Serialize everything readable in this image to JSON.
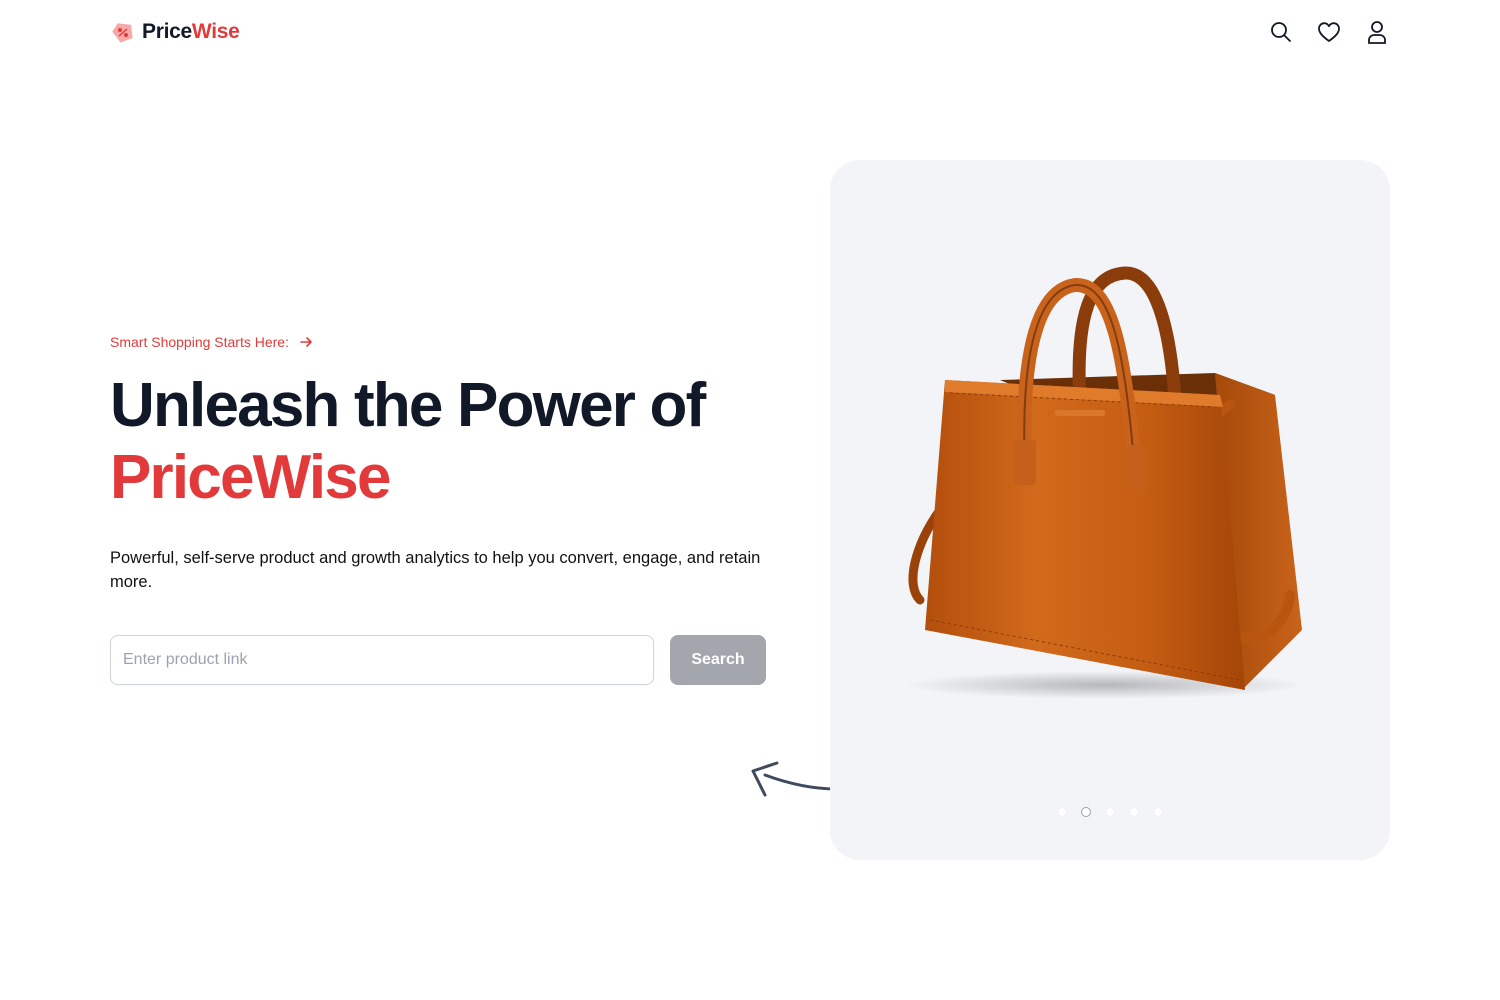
{
  "nav": {
    "logo_part1": "Price",
    "logo_part2": "Wise",
    "logo_icon": "price-tag-icon",
    "icons": [
      "search-icon",
      "heart-icon",
      "user-icon"
    ]
  },
  "hero": {
    "tagline": "Smart Shopping Starts Here:",
    "headline_line1": "Unleash the Power of",
    "headline_brand": "PriceWise",
    "description": "Powerful, self-serve product and growth analytics to help you convert, engage, and retain more.",
    "search": {
      "placeholder": "Enter product link",
      "value": "",
      "button_label": "Search"
    }
  },
  "carousel": {
    "image": "leather-handbag",
    "slide_count": 5,
    "active_index": 1
  },
  "colors": {
    "brand_red": "#e23a3a",
    "text_dark": "#111827",
    "button_disabled": "#a3a6ad",
    "carousel_bg": "#f2f4f8"
  }
}
